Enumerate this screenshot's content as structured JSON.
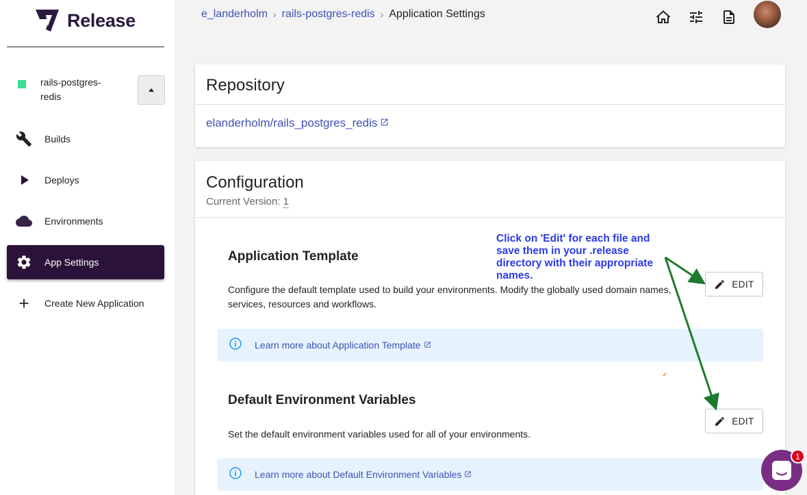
{
  "brand": {
    "name": "Release"
  },
  "sidebar": {
    "app": {
      "name": "rails-postgres-redis",
      "status_color": "#3ddc97"
    },
    "items": [
      {
        "label": "Builds",
        "icon": "wrench-icon"
      },
      {
        "label": "Deploys",
        "icon": "play-icon"
      },
      {
        "label": "Environments",
        "icon": "cloud-icon"
      },
      {
        "label": "App Settings",
        "icon": "gear-icon",
        "active": true
      },
      {
        "label": "Create New Application",
        "icon": "plus-icon"
      }
    ]
  },
  "breadcrumb": {
    "items": [
      "e_landerholm",
      "rails-postgres-redis"
    ],
    "current": "Application Settings"
  },
  "topbar": {
    "icons": [
      "home-icon",
      "tune-icon",
      "document-icon",
      "avatar"
    ]
  },
  "repository": {
    "title": "Repository",
    "link": "elanderholm/rails_postgres_redis"
  },
  "configuration": {
    "title": "Configuration",
    "version_label": "Current Version:",
    "version_value": "1",
    "sections": [
      {
        "title": "Application Template",
        "description": "Configure the default template used to build your environments. Modify the globally used domain names, services, resources and workflows.",
        "edit_label": "EDIT",
        "info": "Learn more about Application Template"
      },
      {
        "title": "Default Environment Variables",
        "description": "Set the default environment variables used for all of your environments.",
        "edit_label": "EDIT",
        "info": "Learn more about Default Environment Variables"
      }
    ]
  },
  "annotation": {
    "text": "Click on 'Edit' for each file and save them in your .release directory with their appropriate names.",
    "color": "#2b3ae6",
    "arrow_color": "#1e7a2e"
  },
  "chat": {
    "badge": "1",
    "color": "#7a2d84"
  },
  "colors": {
    "accent": "#3f51b5",
    "sidebar_active": "#2a1238",
    "info_bg": "#e6f3fe"
  }
}
